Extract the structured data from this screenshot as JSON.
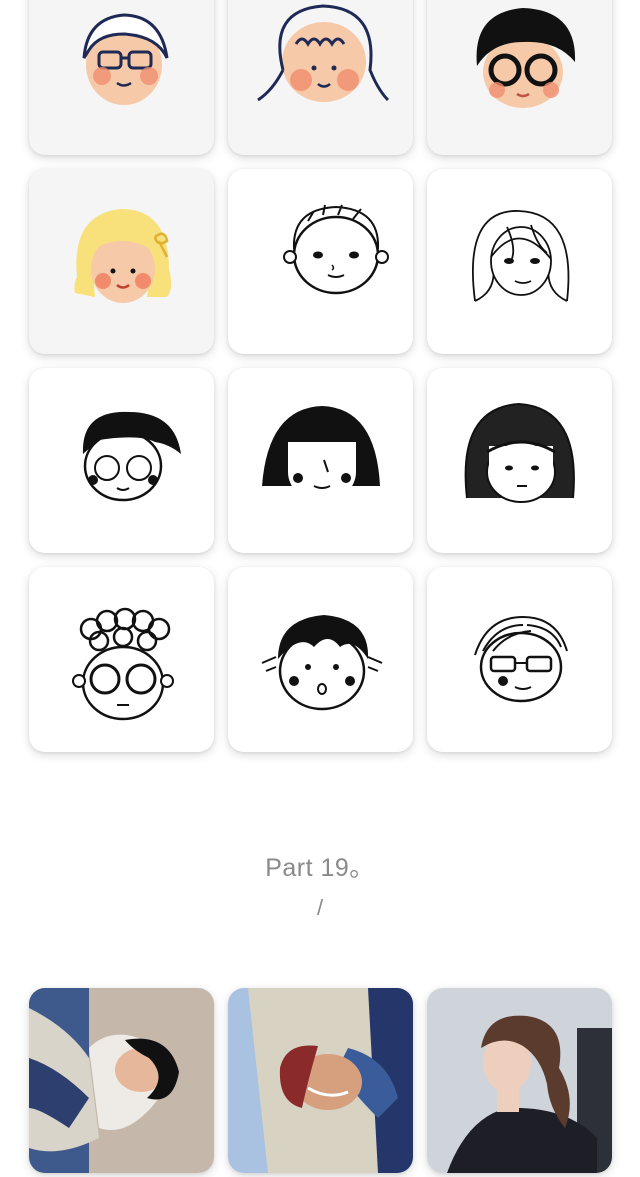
{
  "section": {
    "title": "Part 19。",
    "separator": "/"
  },
  "avatar_grid": {
    "style_colors": {
      "skin": "#f6c9a8",
      "blush": "#f09070",
      "yellow_hair": "#f8e07a",
      "ink": "#111111",
      "navy_line": "#1e2a55"
    },
    "items": [
      {
        "name": "avatar-glasses-grey-hair",
        "colored": true
      },
      {
        "name": "avatar-wavy-hair-blush",
        "colored": true
      },
      {
        "name": "avatar-black-curly-glasses",
        "colored": true
      },
      {
        "name": "avatar-yellow-bob-bow",
        "colored": true
      },
      {
        "name": "avatar-sketch-short-hair",
        "colored": false
      },
      {
        "name": "avatar-sketch-long-hair",
        "colored": false
      },
      {
        "name": "avatar-sketch-side-swept-glasses",
        "colored": false
      },
      {
        "name": "avatar-sketch-black-bob",
        "colored": false
      },
      {
        "name": "avatar-sketch-scribble-bob",
        "colored": false
      },
      {
        "name": "avatar-sketch-curly-round-glasses",
        "colored": false
      },
      {
        "name": "avatar-sketch-messy-hair-surprised",
        "colored": false
      },
      {
        "name": "avatar-sketch-lined-hair-glasses",
        "colored": false
      }
    ]
  },
  "photo_grid": {
    "items": [
      {
        "name": "photo-girl-lying-laughing"
      },
      {
        "name": "photo-boy-red-beanie-lying"
      },
      {
        "name": "photo-girl-ponytail-profile"
      }
    ]
  }
}
